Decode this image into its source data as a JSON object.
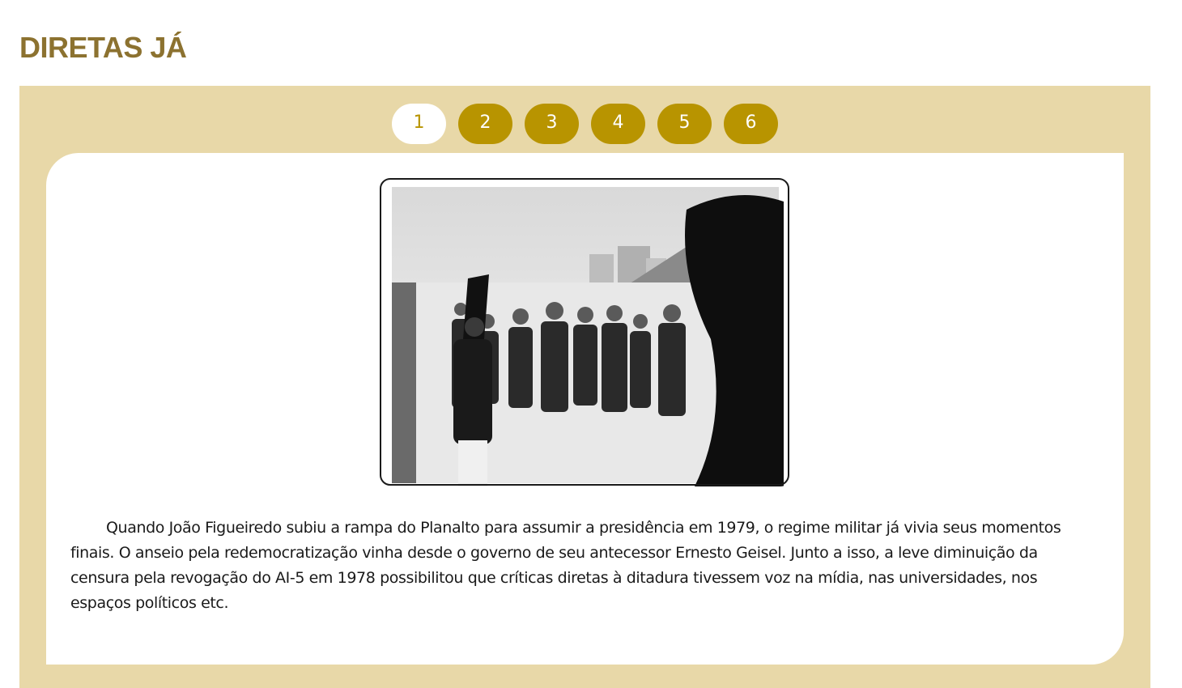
{
  "page": {
    "title": "DIRETAS JÁ"
  },
  "pager": {
    "pages": [
      "1",
      "2",
      "3",
      "4",
      "5",
      "6"
    ],
    "active": "1"
  },
  "slide": {
    "caption": "Quando João Figueiredo subiu a rampa do Planalto para assumir a presidência em 1979, o regime militar já vivia seus momentos finais. O anseio pela redemocratização vinha desde o governo de seu antecessor Ernesto Geisel. Junto a isso, a leve diminuição da censura pela revogação do AI-5 em 1978 possibilitou que críticas diretas à ditadura tivessem voz na mídia, nas universidades, nos espaços políticos etc."
  },
  "colors": {
    "title": "#8c7230",
    "panel_background": "#e8d8a8",
    "page_button": "#b89400",
    "page_button_active_bg": "#ffffff"
  }
}
